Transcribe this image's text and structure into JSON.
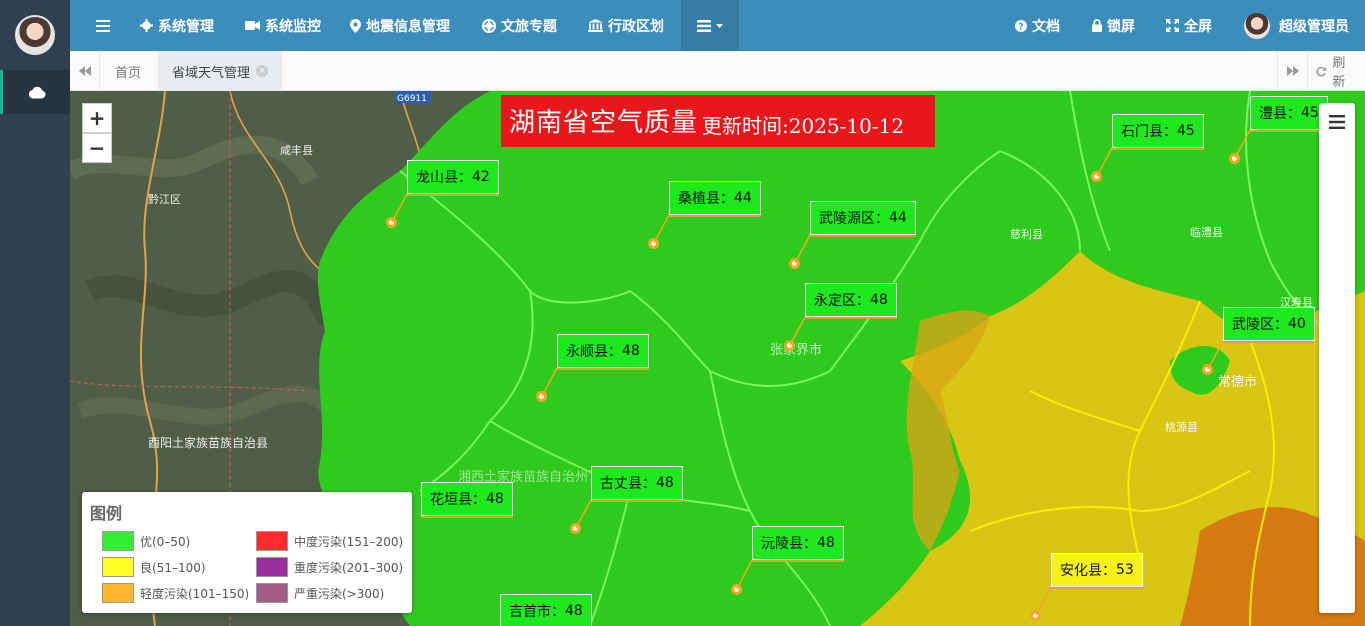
{
  "sidebar": {
    "weather_icon": "cloud-icon"
  },
  "navbar": {
    "toggle_icon": "bars-icon",
    "items": [
      {
        "label": "系统管理",
        "icon": "gear-icon"
      },
      {
        "label": "系统监控",
        "icon": "video-camera-icon"
      },
      {
        "label": "地震信息管理",
        "icon": "map-marker-icon"
      },
      {
        "label": "文旅专题",
        "icon": "life-ring-icon"
      },
      {
        "label": "行政区划",
        "icon": "bank-icon"
      }
    ],
    "more_icon": "list-icon",
    "right": [
      {
        "label": "文档",
        "icon": "question-circle-icon"
      },
      {
        "label": "锁屏",
        "icon": "lock-icon"
      },
      {
        "label": "全屏",
        "icon": "arrows-icon"
      }
    ],
    "user": "超级管理员"
  },
  "tabs": {
    "home": "首页",
    "active": "省域天气管理",
    "refresh": "刷新"
  },
  "map": {
    "zoom_in": "+",
    "zoom_out": "−",
    "title": "湖南省空气质量",
    "update_time": "更新时间:2025-10-12",
    "counties": [
      {
        "name": "龙山县",
        "aqi": 42
      },
      {
        "name": "桑植县",
        "aqi": 44
      },
      {
        "name": "武陵源区",
        "aqi": 44
      },
      {
        "name": "永定区",
        "aqi": 48
      },
      {
        "name": "石门县",
        "aqi": 45
      },
      {
        "name": "澧县",
        "aqi": 45
      },
      {
        "name": "永顺县",
        "aqi": 48
      },
      {
        "name": "武陵区",
        "aqi": 40
      },
      {
        "name": "古丈县",
        "aqi": 48
      },
      {
        "name": "花垣县",
        "aqi": 48
      },
      {
        "name": "沅陵县",
        "aqi": 48
      },
      {
        "name": "安化县",
        "aqi": 53
      },
      {
        "name": "吉首市",
        "aqi": 48
      }
    ],
    "place_names": {
      "xianfeng": "咸丰县",
      "qianjiang": "黔江区",
      "youyang": "酉阳土家族苗族自治县",
      "zhangjiajie": "张家界市",
      "changde": "常德市",
      "xiangxi": "湘西土家族苗族自治州",
      "cili": "慈利县",
      "taoyuan": "桃源县",
      "hanshou": "汉寿县",
      "linli": "临澧县"
    },
    "road_label": "G6911"
  },
  "legend": {
    "title": "图例",
    "items": [
      {
        "label": "优(0–50)",
        "color": "#33ee33"
      },
      {
        "label": "良(51–100)",
        "color": "#ffff22"
      },
      {
        "label": "轻度污染(101–150)",
        "color": "#ffb733"
      },
      {
        "label": "中度污染(151–200)",
        "color": "#ff2d2d"
      },
      {
        "label": "重度污染(201–300)",
        "color": "#992d99"
      },
      {
        "label": "严重污染(>300)",
        "color": "#a35e85"
      }
    ]
  }
}
